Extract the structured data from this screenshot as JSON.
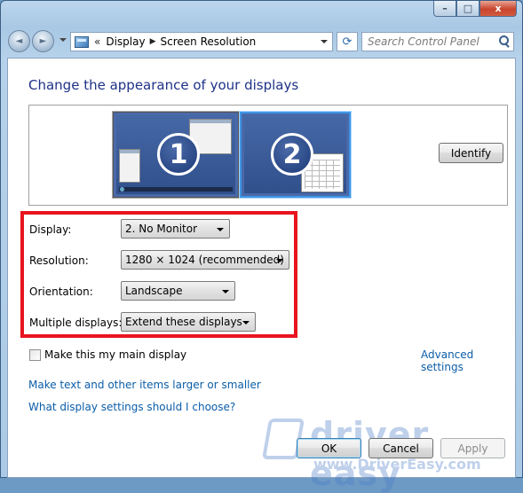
{
  "window": {
    "minimize_glyph": "–",
    "maximize_glyph": "□",
    "close_glyph": "x"
  },
  "nav": {
    "back_glyph": "◄",
    "forward_glyph": "►",
    "address_sep": "«",
    "breadcrumb": [
      "Display",
      "Screen Resolution"
    ],
    "breadcrumb_arrow": "▶",
    "refresh_glyph": "⟳",
    "search_placeholder": "Search Control Panel"
  },
  "page": {
    "title": "Change the appearance of your displays"
  },
  "preview": {
    "monitor1_label": "1",
    "monitor2_label": "2",
    "identify_label": "Identify"
  },
  "settings": {
    "display_label": "Display:",
    "display_value": "2. No Monitor",
    "resolution_label": "Resolution:",
    "resolution_value": "1280 × 1024 (recommended)",
    "orientation_label": "Orientation:",
    "orientation_value": "Landscape",
    "multiple_label": "Multiple displays:",
    "multiple_value": "Extend these displays"
  },
  "main_display": {
    "label": "Make this my main display",
    "checked": false
  },
  "links": {
    "advanced": "Advanced settings",
    "text_size": "Make text and other items larger or smaller",
    "help": "What display settings should I choose?"
  },
  "buttons": {
    "ok": "OK",
    "cancel": "Cancel",
    "apply": "Apply"
  },
  "watermark": {
    "brand": "driver easy",
    "url": "www.DriverEasy.com"
  },
  "colors": {
    "highlight": "#e8141f",
    "title": "#1e3287",
    "link": "#0b5da8"
  }
}
